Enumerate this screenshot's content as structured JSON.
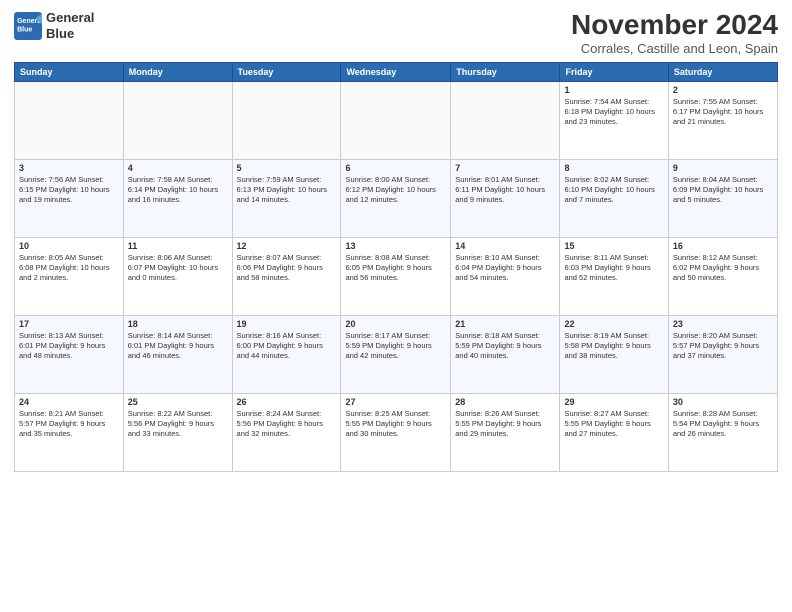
{
  "logo": {
    "name": "General Blue",
    "line1": "General",
    "line2": "Blue"
  },
  "title": "November 2024",
  "location": "Corrales, Castille and Leon, Spain",
  "weekdays": [
    "Sunday",
    "Monday",
    "Tuesday",
    "Wednesday",
    "Thursday",
    "Friday",
    "Saturday"
  ],
  "weeks": [
    [
      {
        "day": "",
        "info": ""
      },
      {
        "day": "",
        "info": ""
      },
      {
        "day": "",
        "info": ""
      },
      {
        "day": "",
        "info": ""
      },
      {
        "day": "",
        "info": ""
      },
      {
        "day": "1",
        "info": "Sunrise: 7:54 AM\nSunset: 6:18 PM\nDaylight: 10 hours and 23 minutes."
      },
      {
        "day": "2",
        "info": "Sunrise: 7:55 AM\nSunset: 6:17 PM\nDaylight: 10 hours and 21 minutes."
      }
    ],
    [
      {
        "day": "3",
        "info": "Sunrise: 7:56 AM\nSunset: 6:15 PM\nDaylight: 10 hours and 19 minutes."
      },
      {
        "day": "4",
        "info": "Sunrise: 7:58 AM\nSunset: 6:14 PM\nDaylight: 10 hours and 16 minutes."
      },
      {
        "day": "5",
        "info": "Sunrise: 7:59 AM\nSunset: 6:13 PM\nDaylight: 10 hours and 14 minutes."
      },
      {
        "day": "6",
        "info": "Sunrise: 8:00 AM\nSunset: 6:12 PM\nDaylight: 10 hours and 12 minutes."
      },
      {
        "day": "7",
        "info": "Sunrise: 8:01 AM\nSunset: 6:11 PM\nDaylight: 10 hours and 9 minutes."
      },
      {
        "day": "8",
        "info": "Sunrise: 8:02 AM\nSunset: 6:10 PM\nDaylight: 10 hours and 7 minutes."
      },
      {
        "day": "9",
        "info": "Sunrise: 8:04 AM\nSunset: 6:09 PM\nDaylight: 10 hours and 5 minutes."
      }
    ],
    [
      {
        "day": "10",
        "info": "Sunrise: 8:05 AM\nSunset: 6:08 PM\nDaylight: 10 hours and 2 minutes."
      },
      {
        "day": "11",
        "info": "Sunrise: 8:06 AM\nSunset: 6:07 PM\nDaylight: 10 hours and 0 minutes."
      },
      {
        "day": "12",
        "info": "Sunrise: 8:07 AM\nSunset: 6:06 PM\nDaylight: 9 hours and 58 minutes."
      },
      {
        "day": "13",
        "info": "Sunrise: 8:08 AM\nSunset: 6:05 PM\nDaylight: 9 hours and 56 minutes."
      },
      {
        "day": "14",
        "info": "Sunrise: 8:10 AM\nSunset: 6:04 PM\nDaylight: 9 hours and 54 minutes."
      },
      {
        "day": "15",
        "info": "Sunrise: 8:11 AM\nSunset: 6:03 PM\nDaylight: 9 hours and 52 minutes."
      },
      {
        "day": "16",
        "info": "Sunrise: 8:12 AM\nSunset: 6:02 PM\nDaylight: 9 hours and 50 minutes."
      }
    ],
    [
      {
        "day": "17",
        "info": "Sunrise: 8:13 AM\nSunset: 6:01 PM\nDaylight: 9 hours and 48 minutes."
      },
      {
        "day": "18",
        "info": "Sunrise: 8:14 AM\nSunset: 6:01 PM\nDaylight: 9 hours and 46 minutes."
      },
      {
        "day": "19",
        "info": "Sunrise: 8:16 AM\nSunset: 6:00 PM\nDaylight: 9 hours and 44 minutes."
      },
      {
        "day": "20",
        "info": "Sunrise: 8:17 AM\nSunset: 5:59 PM\nDaylight: 9 hours and 42 minutes."
      },
      {
        "day": "21",
        "info": "Sunrise: 8:18 AM\nSunset: 5:59 PM\nDaylight: 9 hours and 40 minutes."
      },
      {
        "day": "22",
        "info": "Sunrise: 8:19 AM\nSunset: 5:58 PM\nDaylight: 9 hours and 38 minutes."
      },
      {
        "day": "23",
        "info": "Sunrise: 8:20 AM\nSunset: 5:57 PM\nDaylight: 9 hours and 37 minutes."
      }
    ],
    [
      {
        "day": "24",
        "info": "Sunrise: 8:21 AM\nSunset: 5:57 PM\nDaylight: 9 hours and 35 minutes."
      },
      {
        "day": "25",
        "info": "Sunrise: 8:22 AM\nSunset: 5:56 PM\nDaylight: 9 hours and 33 minutes."
      },
      {
        "day": "26",
        "info": "Sunrise: 8:24 AM\nSunset: 5:56 PM\nDaylight: 9 hours and 32 minutes."
      },
      {
        "day": "27",
        "info": "Sunrise: 8:25 AM\nSunset: 5:55 PM\nDaylight: 9 hours and 30 minutes."
      },
      {
        "day": "28",
        "info": "Sunrise: 8:26 AM\nSunset: 5:55 PM\nDaylight: 9 hours and 29 minutes."
      },
      {
        "day": "29",
        "info": "Sunrise: 8:27 AM\nSunset: 5:55 PM\nDaylight: 9 hours and 27 minutes."
      },
      {
        "day": "30",
        "info": "Sunrise: 8:28 AM\nSunset: 5:54 PM\nDaylight: 9 hours and 26 minutes."
      }
    ]
  ]
}
